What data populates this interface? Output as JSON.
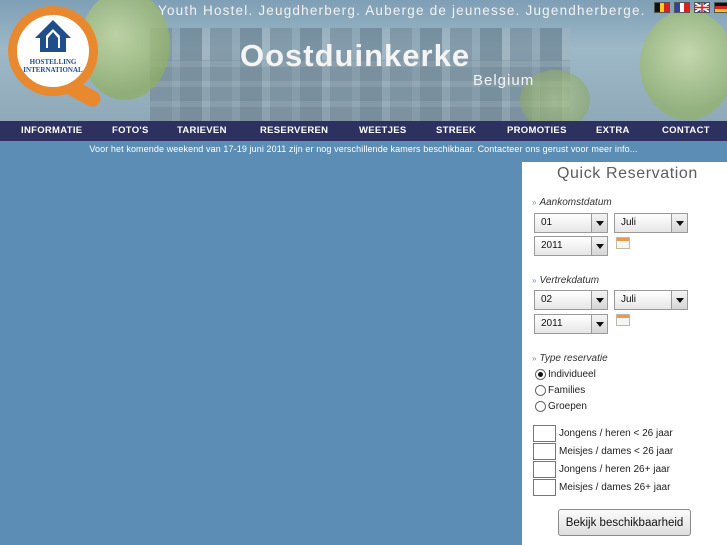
{
  "header": {
    "tagline": "Youth Hostel. Jeugdherberg. Auberge de jeunesse. Jugendherberge.",
    "title": "Oostduinkerke",
    "subtitle": "Belgium",
    "logo_text": "HOSTELLING INTERNATIONAL",
    "flags": [
      "be",
      "fr",
      "gb",
      "de"
    ]
  },
  "nav": {
    "items": [
      "INFORMATIE",
      "FOTO'S",
      "TARIEVEN",
      "RESERVEREN",
      "WEETJES",
      "STREEK",
      "PROMOTIES",
      "EXTRA",
      "CONTACT"
    ]
  },
  "notice": "Voor het komende weekend van 17-19 juni 2011 zijn er nog verschillende kamers beschikbaar. Contacteer ons gerust voor meer info...",
  "reservation": {
    "title": "Quick Reservation",
    "arrival_label": "Aankomstdatum",
    "arrival": {
      "day": "01",
      "month": "Juli",
      "year": "2011"
    },
    "departure_label": "Vertrekdatum",
    "departure": {
      "day": "02",
      "month": "Juli",
      "year": "2011"
    },
    "type_label": "Type reservatie",
    "types": [
      "Individueel",
      "Families",
      "Groepen"
    ],
    "selected_type": "Individueel",
    "guests": [
      "Jongens / heren < 26 jaar",
      "Meisjes / dames < 26 jaar",
      "Jongens / heren 26+ jaar",
      "Meisjes / dames 26+ jaar"
    ],
    "submit_label": "Bekijk beschikbaarheid"
  },
  "colors": {
    "nav_bg": "#2d3160",
    "page_bg": "#5b8db5",
    "logo_orange": "#e8892f"
  }
}
